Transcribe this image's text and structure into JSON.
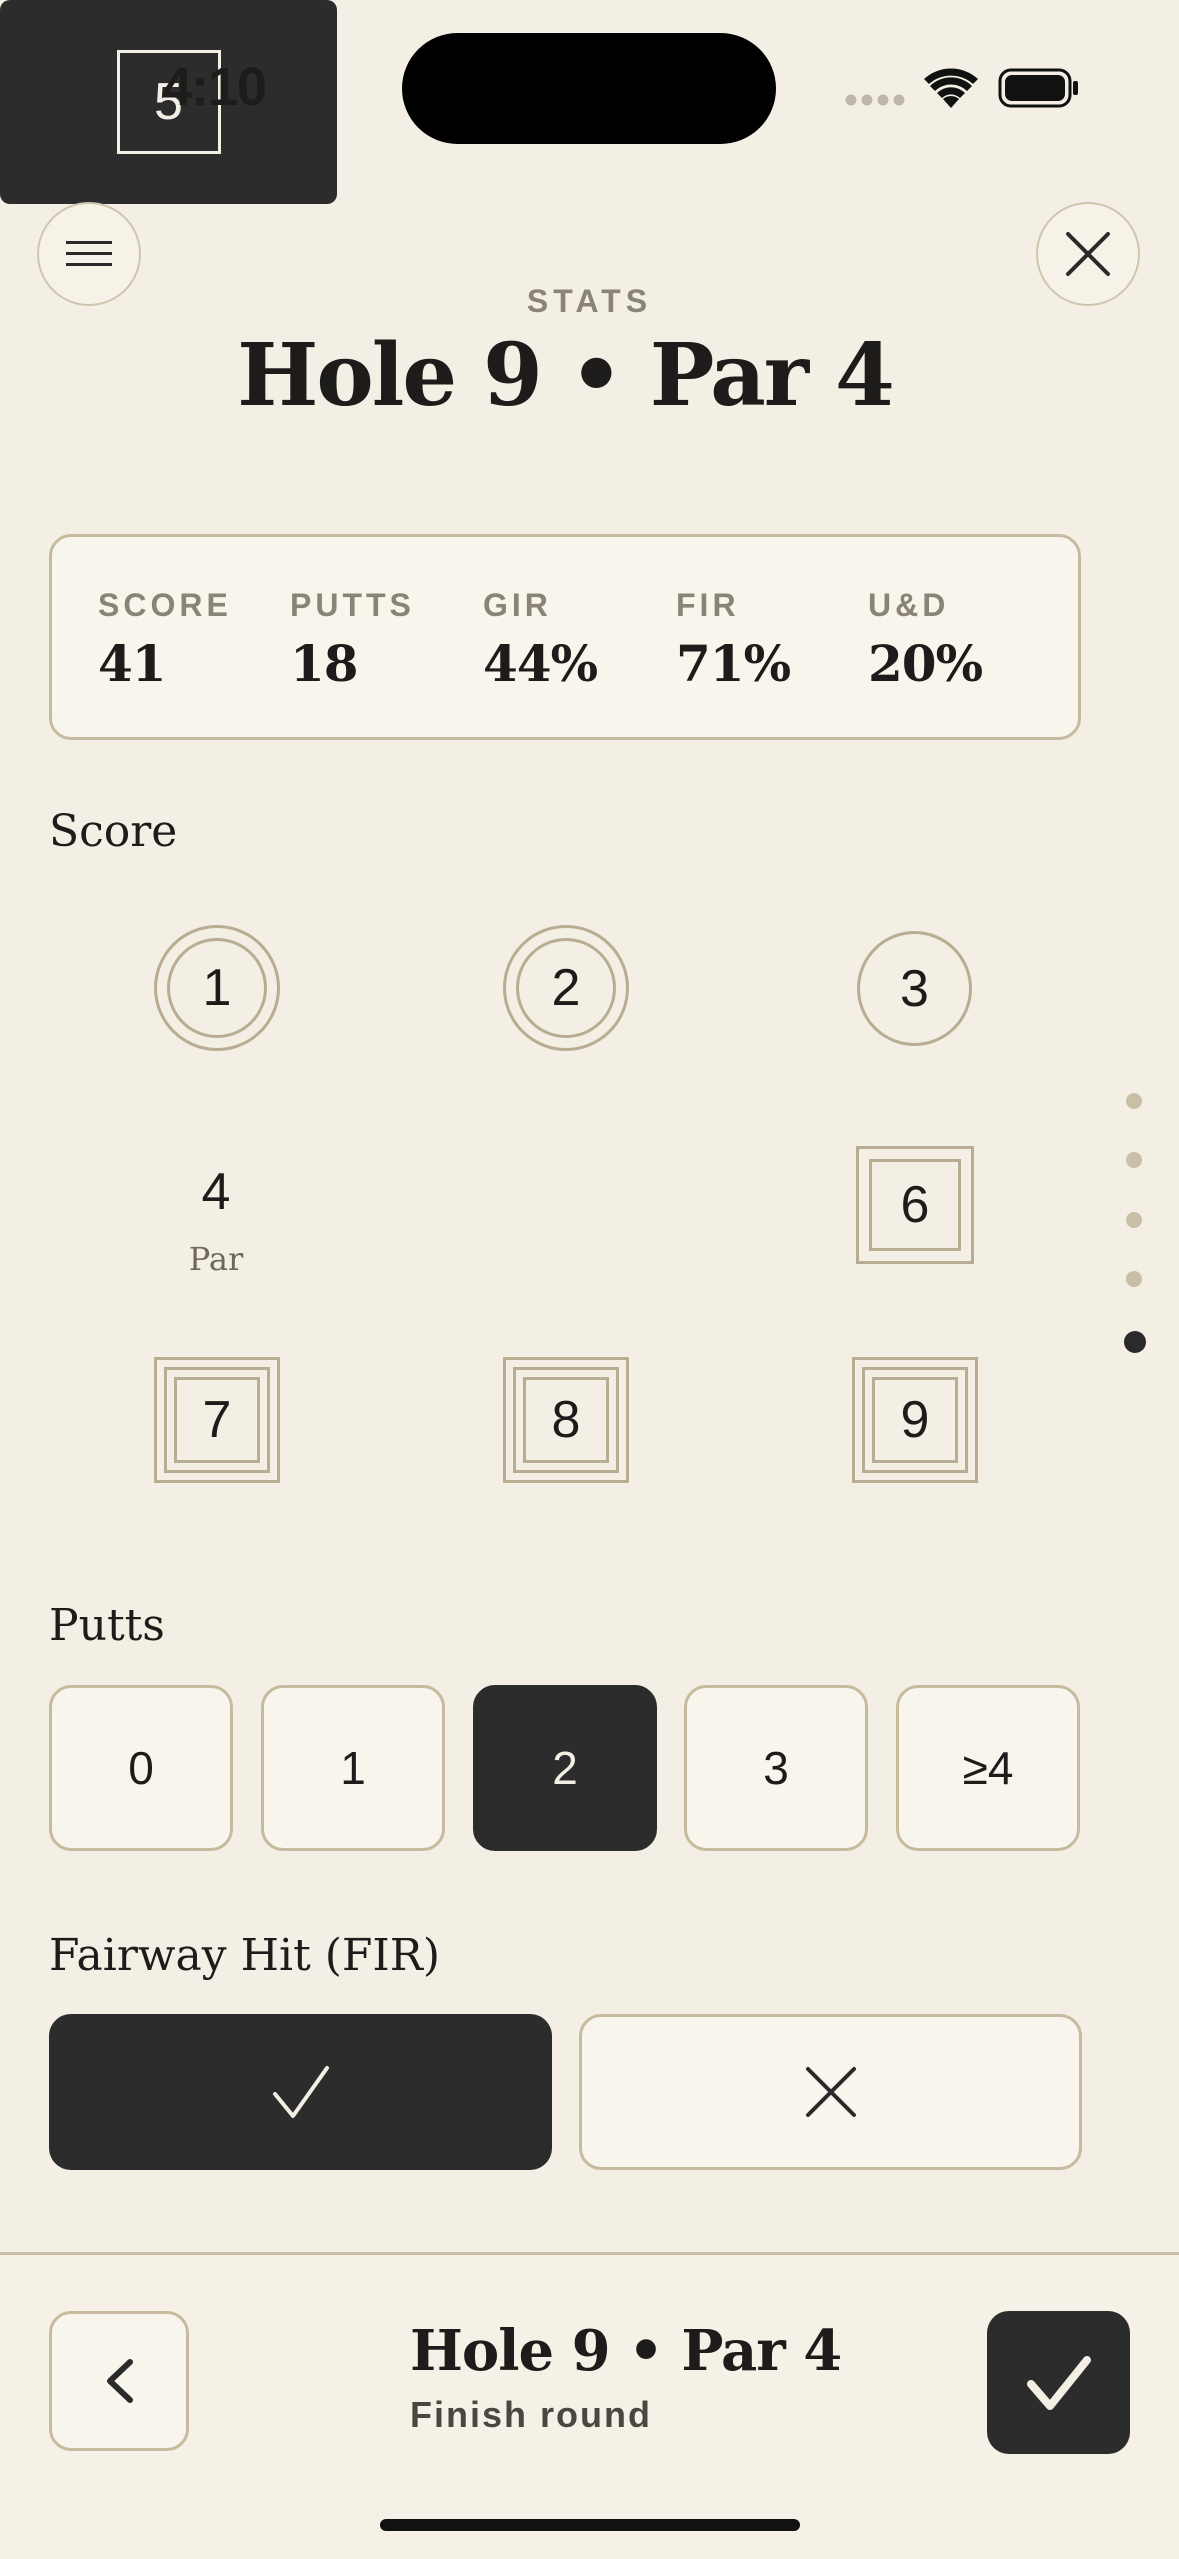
{
  "status_bar": {
    "time": "4:10"
  },
  "header": {
    "kicker": "STATS",
    "title": "Hole 9 • Par 4"
  },
  "stats": [
    {
      "label": "SCORE",
      "value": "41"
    },
    {
      "label": "PUTTS",
      "value": "18"
    },
    {
      "label": "GIR",
      "value": "44%"
    },
    {
      "label": "FIR",
      "value": "71%"
    },
    {
      "label": "U&D",
      "value": "20%"
    }
  ],
  "score_section": {
    "title": "Score",
    "options": [
      "1",
      "2",
      "3",
      "4",
      "5",
      "6",
      "7",
      "8",
      "9"
    ],
    "par_label": "Par",
    "selected": "5"
  },
  "putts_section": {
    "title": "Putts",
    "options": [
      "0",
      "1",
      "2",
      "3",
      "≥4"
    ],
    "selected": "2"
  },
  "fairway_section": {
    "title": "Fairway Hit (FIR)",
    "selected": "hit"
  },
  "page_indicator": {
    "total": 5,
    "current": 5
  },
  "footer": {
    "title": "Hole 9 • Par 4",
    "subtitle": "Finish round"
  },
  "colors": {
    "background": "#f3efe5",
    "dark": "#2c2c2c",
    "border": "#c6bb9f",
    "card": "#f8f5ec"
  }
}
